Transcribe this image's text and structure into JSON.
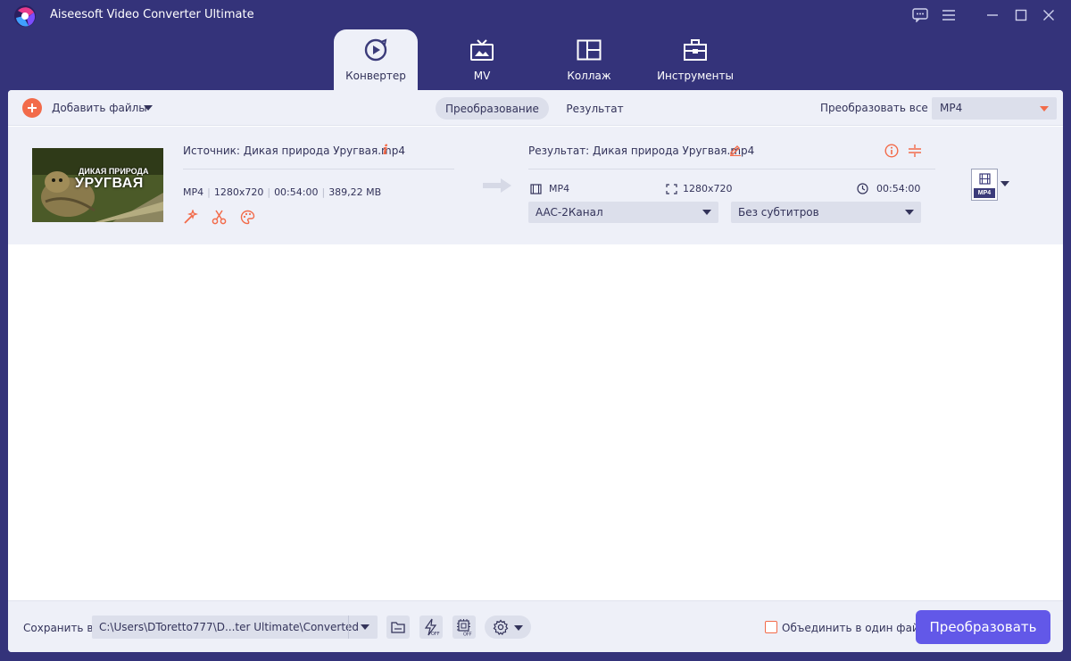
{
  "window": {
    "title": "Aiseesoft Video Converter Ultimate"
  },
  "tabs": [
    {
      "label": "Конвертер",
      "active": true,
      "icon": "play-convert-icon"
    },
    {
      "label": "MV",
      "active": false,
      "icon": "tv-icon"
    },
    {
      "label": "Коллаж",
      "active": false,
      "icon": "collage-icon"
    },
    {
      "label": "Инструменты",
      "active": false,
      "icon": "toolbox-icon"
    }
  ],
  "toolbar": {
    "add_files_label": "Добавить файлы",
    "seg_converting": "Преобразование",
    "seg_converted": "Результат",
    "convert_all_label": "Преобразовать все в:",
    "convert_all_value": "MP4"
  },
  "file": {
    "thumbnail_line1": "ДИКАЯ ПРИРОДА",
    "thumbnail_line2": "УРУГВАЯ",
    "source_label": "Источник: Дикая природа Уругвая.mp4",
    "info_glyph": "i",
    "src_format": "MP4",
    "src_resolution": "1280x720",
    "src_duration": "00:54:00",
    "src_size": "389,22 MB",
    "output_label": "Результат: Дикая природа Уругвая.mp4",
    "out_format": "MP4",
    "out_resolution": "1280x720",
    "out_duration": "00:54:00",
    "audio_track": "AAC-2Канал",
    "subtitle": "Без субтитров",
    "format_badge": "MP4"
  },
  "bottom": {
    "save_to_label": "Сохранить в:",
    "save_path": "C:\\Users\\DToretto777\\D...ter Ultimate\\Converted",
    "merge_label": "Объединить в один файл",
    "merge_checked": false,
    "convert_button": "Преобразовать"
  },
  "colors": {
    "frame": "#34337a",
    "panel_bg": "#eef0f8",
    "accent": "#f26b4a",
    "primary_button": "#6258e8"
  }
}
